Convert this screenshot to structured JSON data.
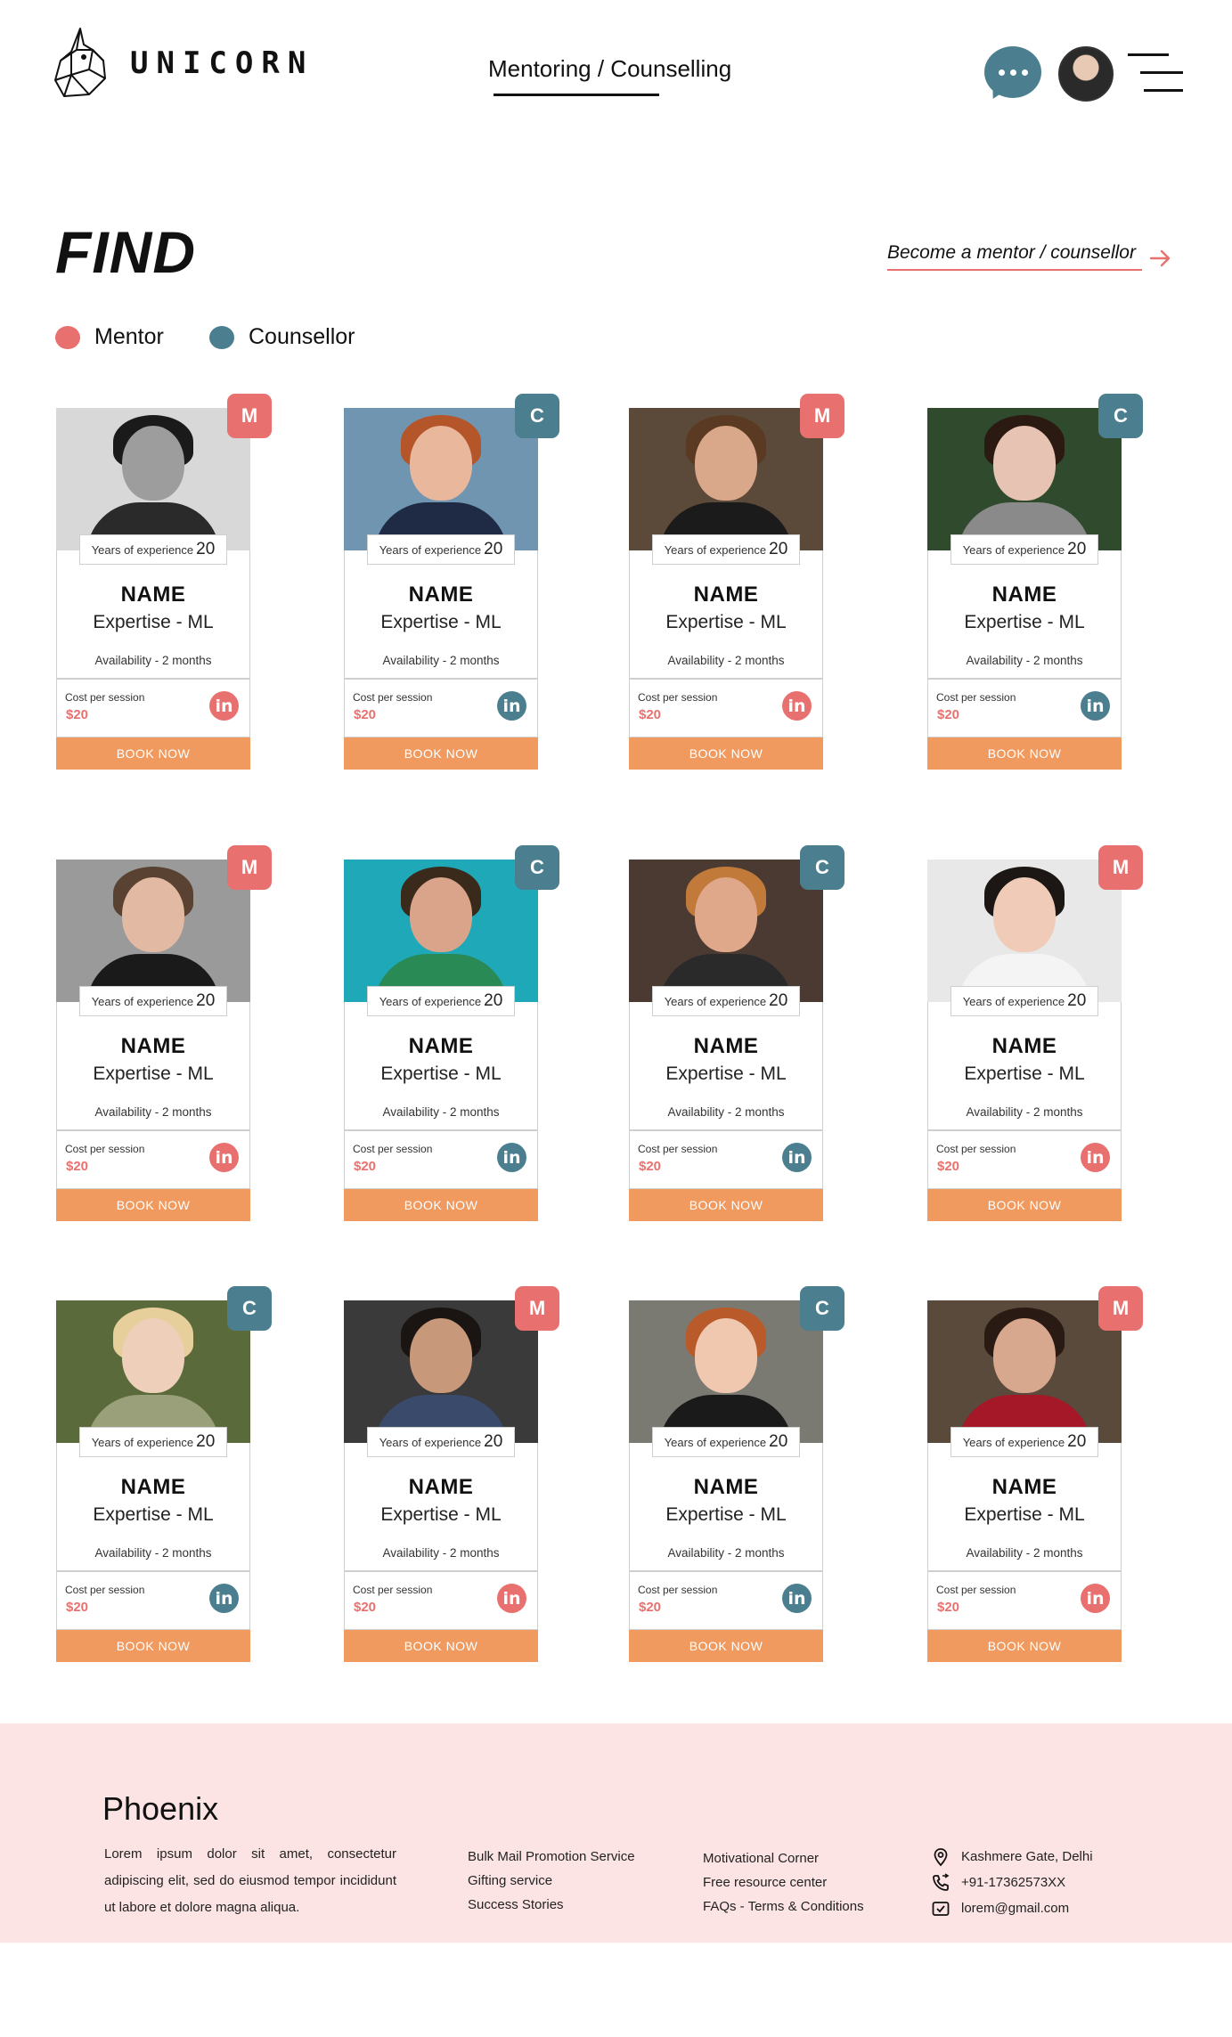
{
  "colors": {
    "mentor": "#e8716f",
    "counsellor": "#4b7f8f",
    "book_button": "#f09a5f",
    "footer_bg": "#fce4e4"
  },
  "header": {
    "logo_text": "UNICORN",
    "nav_link": "Mentoring / Counselling",
    "chat_icon": "chat-bubble-icon",
    "menu_icon": "hamburger-menu-icon"
  },
  "find": {
    "title": "FIND",
    "become_link": "Become a mentor / counsellor",
    "legend": {
      "mentor": "Mentor",
      "counsellor": "Counsellor"
    }
  },
  "cards": [
    {
      "type": "M",
      "exp_label": "Years of experience",
      "exp_value": "20",
      "name": "NAME",
      "expertise": "Expertise - ML",
      "availability": "Availability - 2 months",
      "cost_label": "Cost per session",
      "cost": "$20",
      "linkedin": "in",
      "book": "BOOK NOW"
    },
    {
      "type": "C",
      "exp_label": "Years of experience",
      "exp_value": "20",
      "name": "NAME",
      "expertise": "Expertise - ML",
      "availability": "Availability - 2 months",
      "cost_label": "Cost per session",
      "cost": "$20",
      "linkedin": "in",
      "book": "BOOK NOW"
    },
    {
      "type": "M",
      "exp_label": "Years of experience",
      "exp_value": "20",
      "name": "NAME",
      "expertise": "Expertise - ML",
      "availability": "Availability - 2 months",
      "cost_label": "Cost per session",
      "cost": "$20",
      "linkedin": "in",
      "book": "BOOK NOW"
    },
    {
      "type": "C",
      "exp_label": "Years of experience",
      "exp_value": "20",
      "name": "NAME",
      "expertise": "Expertise - ML",
      "availability": "Availability - 2 months",
      "cost_label": "Cost per session",
      "cost": "$20",
      "linkedin": "in",
      "book": "BOOK NOW"
    },
    {
      "type": "M",
      "exp_label": "Years of experience",
      "exp_value": "20",
      "name": "NAME",
      "expertise": "Expertise - ML",
      "availability": "Availability - 2 months",
      "cost_label": "Cost per session",
      "cost": "$20",
      "linkedin": "in",
      "book": "BOOK NOW"
    },
    {
      "type": "C",
      "exp_label": "Years of experience",
      "exp_value": "20",
      "name": "NAME",
      "expertise": "Expertise - ML",
      "availability": "Availability - 2 months",
      "cost_label": "Cost per session",
      "cost": "$20",
      "linkedin": "in",
      "book": "BOOK NOW"
    },
    {
      "type": "C",
      "exp_label": "Years of experience",
      "exp_value": "20",
      "name": "NAME",
      "expertise": "Expertise - ML",
      "availability": "Availability - 2 months",
      "cost_label": "Cost per session",
      "cost": "$20",
      "linkedin": "in",
      "book": "BOOK NOW"
    },
    {
      "type": "M",
      "exp_label": "Years of experience",
      "exp_value": "20",
      "name": "NAME",
      "expertise": "Expertise - ML",
      "availability": "Availability - 2 months",
      "cost_label": "Cost per session",
      "cost": "$20",
      "linkedin": "in",
      "book": "BOOK NOW"
    },
    {
      "type": "C",
      "exp_label": "Years of experience",
      "exp_value": "20",
      "name": "NAME",
      "expertise": "Expertise - ML",
      "availability": "Availability - 2 months",
      "cost_label": "Cost per session",
      "cost": "$20",
      "linkedin": "in",
      "book": "BOOK NOW"
    },
    {
      "type": "M",
      "exp_label": "Years of experience",
      "exp_value": "20",
      "name": "NAME",
      "expertise": "Expertise - ML",
      "availability": "Availability - 2 months",
      "cost_label": "Cost per session",
      "cost": "$20",
      "linkedin": "in",
      "book": "BOOK NOW"
    },
    {
      "type": "C",
      "exp_label": "Years of experience",
      "exp_value": "20",
      "name": "NAME",
      "expertise": "Expertise - ML",
      "availability": "Availability - 2 months",
      "cost_label": "Cost per session",
      "cost": "$20",
      "linkedin": "in",
      "book": "BOOK NOW"
    },
    {
      "type": "M",
      "exp_label": "Years of experience",
      "exp_value": "20",
      "name": "NAME",
      "expertise": "Expertise - ML",
      "availability": "Availability - 2 months",
      "cost_label": "Cost per session",
      "cost": "$20",
      "linkedin": "in",
      "book": "BOOK NOW"
    }
  ],
  "footer": {
    "brand": "Phoenix",
    "description": "Lorem ipsum dolor sit amet, consectetur adipiscing elit, sed do eiusmod tempor incididunt ut labore et dolore magna aliqua.",
    "col1": [
      "Bulk Mail Promotion Service",
      "Gifting service",
      "Success Stories"
    ],
    "col2": [
      "Motivational Corner",
      "Free resource center",
      "FAQs - Terms & Conditions"
    ],
    "contact": {
      "address": "Kashmere Gate, Delhi",
      "phone": "+91-17362573XX",
      "email": "lorem@gmail.com"
    }
  }
}
